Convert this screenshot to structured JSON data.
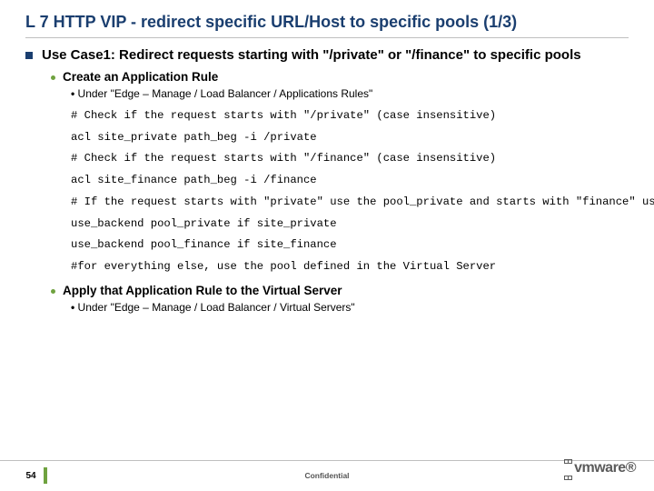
{
  "title": "L 7 HTTP VIP - redirect specific URL/Host to specific pools (1/3)",
  "use_case_heading": "Use Case1: Redirect requests starting with \"/private\" or \"/finance\" to specific pools",
  "step1": {
    "heading": "Create an Application Rule",
    "path": "Under \"Edge – Manage /  Load Balancer / Applications Rules\"",
    "code": "# Check if the request starts with \"/private\" (case insensitive)\nacl site_private path_beg -i /private\n# Check if the request starts with \"/finance\" (case insensitive)\nacl site_finance path_beg -i /finance\n# If the request starts with \"private\" use the pool_private and starts with \"finance\" use the pool_finance\nuse_backend pool_private if site_private\nuse_backend pool_finance if site_finance\n#for everything else, use the pool defined in the Virtual Server"
  },
  "step2": {
    "heading": "Apply that Application Rule to the Virtual Server",
    "path": "Under \"Edge – Manage /  Load Balancer / Virtual Servers\""
  },
  "footer": {
    "page": "54",
    "confidential": "Confidential",
    "logo": "vmware"
  }
}
